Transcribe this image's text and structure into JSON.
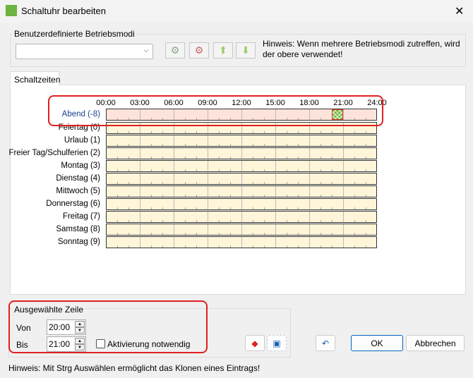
{
  "window": {
    "title": "Schaltuhr bearbeiten"
  },
  "modes": {
    "group_label": "Benutzerdefinierte Betriebsmodi",
    "combo_value": "",
    "hint": "Hinweis: Wenn mehrere Betriebsmodi zutreffen, wird der obere verwendet!"
  },
  "tab": {
    "label": "Schaltzeiten"
  },
  "hours": [
    "00:00",
    "03:00",
    "06:00",
    "09:00",
    "12:00",
    "15:00",
    "18:00",
    "21:00",
    "24:00"
  ],
  "rows": [
    {
      "label": "Abend (-8)",
      "selected": true,
      "blocks": [
        {
          "from": 20,
          "to": 21
        }
      ]
    },
    {
      "label": "Feiertag (0)"
    },
    {
      "label": "Urlaub (1)"
    },
    {
      "label": "Freier Tag/Schulferien (2)"
    },
    {
      "label": "Montag (3)"
    },
    {
      "label": "Dienstag (4)"
    },
    {
      "label": "Mittwoch (5)"
    },
    {
      "label": "Donnerstag (6)"
    },
    {
      "label": "Freitag (7)"
    },
    {
      "label": "Samstag (8)"
    },
    {
      "label": "Sonntag (9)"
    }
  ],
  "selected": {
    "group_label": "Ausgewählte Zeile",
    "von_label": "Von",
    "von": "20:00",
    "bis_label": "Bis",
    "bis": "21:00",
    "activation_label": "Aktivierung notwendig",
    "activation_checked": false
  },
  "buttons": {
    "ok": "OK",
    "cancel": "Abbrechen"
  },
  "footer_hint": "Hinweis: Mit Strg Auswählen ermöglicht das Klonen eines Eintrags!"
}
